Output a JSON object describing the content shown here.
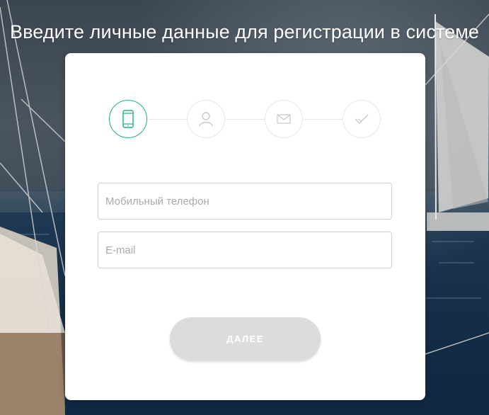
{
  "header": {
    "title": "Введите личные данные для регистрации в системе"
  },
  "steps": [
    {
      "icon": "mobile-phone-icon",
      "state": "active"
    },
    {
      "icon": "user-icon",
      "state": "inactive"
    },
    {
      "icon": "envelope-icon",
      "state": "inactive"
    },
    {
      "icon": "checkmark-icon",
      "state": "inactive"
    }
  ],
  "form": {
    "phone": {
      "value": "",
      "placeholder": "Мобильный телефон"
    },
    "email": {
      "value": "",
      "placeholder": "E-mail"
    },
    "submit_label": "ДАЛЕЕ"
  },
  "colors": {
    "accent": "#19b47f",
    "button_disabled": "#dcdcdc",
    "card": "#ffffff"
  }
}
